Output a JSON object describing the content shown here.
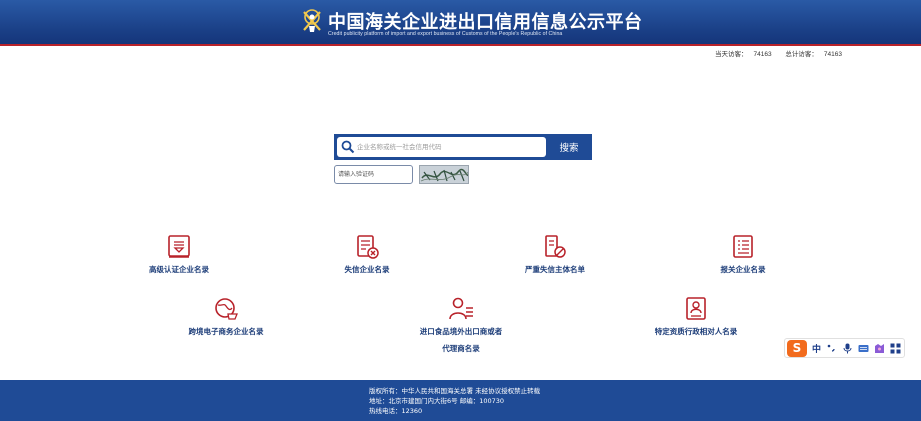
{
  "header": {
    "title_cn": "中国海关企业进出口信用信息公示平台",
    "title_en": "Credit publicity platform of import and export business of Customs of the People's Republic of China"
  },
  "stats": {
    "today_label": "当天访客：",
    "today_value": "74163",
    "total_label": "总计访客：",
    "total_value": "74163"
  },
  "search": {
    "placeholder": "企业名称或统一社会信用代码",
    "button_label": "搜索",
    "captcha_placeholder": "请输入验证码"
  },
  "categories": [
    {
      "label": "高级认证企业名录",
      "icon": "certificate-icon"
    },
    {
      "label": "失信企业名录",
      "icon": "blacklist-icon"
    },
    {
      "label": "严重失信主体名单",
      "icon": "forbidden-document-icon"
    },
    {
      "label": "报关企业名录",
      "icon": "list-document-icon"
    },
    {
      "label": "跨境电子商务企业名录",
      "icon": "globe-cart-icon"
    },
    {
      "label": "进口食品境外出口商或者",
      "label2": "代理商名录",
      "icon": "person-list-icon"
    },
    {
      "label": "特定资质行政相对人名录",
      "icon": "person-document-icon"
    }
  ],
  "ime": {
    "logo": "S",
    "lang": "中"
  },
  "footer": {
    "line1": "版权所有：中华人民共和国海关总署    未经协议授权禁止转载",
    "line2": "地址：北京市建国门内大街6号 邮编：100730",
    "line3": "热线电话：12360"
  },
  "colors": {
    "header_blue": "#1a3f86",
    "accent_red": "#b8222a",
    "footer_blue": "#1f4b96",
    "label_blue": "#1f3f7a"
  }
}
